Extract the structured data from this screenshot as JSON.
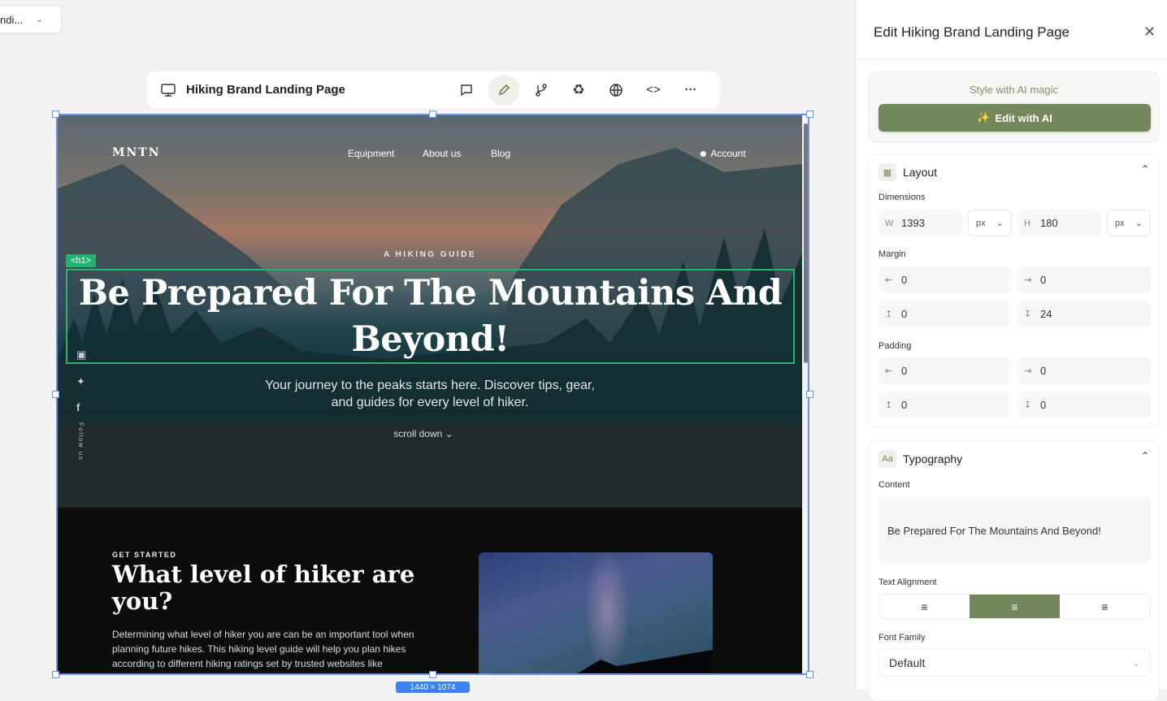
{
  "page_selector": {
    "label": "ndi..."
  },
  "toolbar": {
    "title": "Hiking Brand Landing Page",
    "icons": [
      "desktop-icon",
      "comment-icon",
      "pencil-icon",
      "branch-icon",
      "recycle-icon",
      "globe-icon",
      "code-icon",
      "more-icon"
    ]
  },
  "site": {
    "logo": "MNTN",
    "nav": [
      "Equipment",
      "About us",
      "Blog"
    ],
    "account": "Account",
    "kicker": "A HIKING GUIDE",
    "h1_tag": "<h1>",
    "headline": "Be Prepared For The Mountains And Beyond!",
    "subtitle": "Your journey to the peaks starts here. Discover tips, gear, and guides for every level of hiker.",
    "scroll": "scroll down",
    "follow": "Follow us",
    "section_kicker": "GET STARTED",
    "section_title": "What level of hiker are you?",
    "section_text": "Determining what level of hiker you are can be an important tool when planning future hikes. This hiking level guide will help you plan hikes according to different hiking ratings set by trusted websites like"
  },
  "canvas_size": "1440 × 1074",
  "panel": {
    "title": "Edit Hiking Brand Landing Page",
    "ai_label": "Style with AI magic",
    "ai_button": "Edit with AI",
    "layout": {
      "title": "Layout",
      "dimensions_label": "Dimensions",
      "w_label": "W",
      "w": "1393",
      "w_unit": "px",
      "h_label": "H",
      "h": "180",
      "h_unit": "px",
      "margin_label": "Margin",
      "margin": {
        "left": "0",
        "right": "0",
        "top": "0",
        "bottom": "24"
      },
      "padding_label": "Padding",
      "padding": {
        "left": "0",
        "right": "0",
        "top": "0",
        "bottom": "0"
      }
    },
    "typography": {
      "title": "Typography",
      "content_label": "Content",
      "content": "Be Prepared For The Mountains And Beyond!",
      "alignment_label": "Text Alignment",
      "alignment": "center",
      "font_family_label": "Font Family",
      "font_family": "Default"
    }
  },
  "colors": {
    "accent": "#74875a",
    "selection": "#6a93e0",
    "h1_outline": "#24b572"
  }
}
